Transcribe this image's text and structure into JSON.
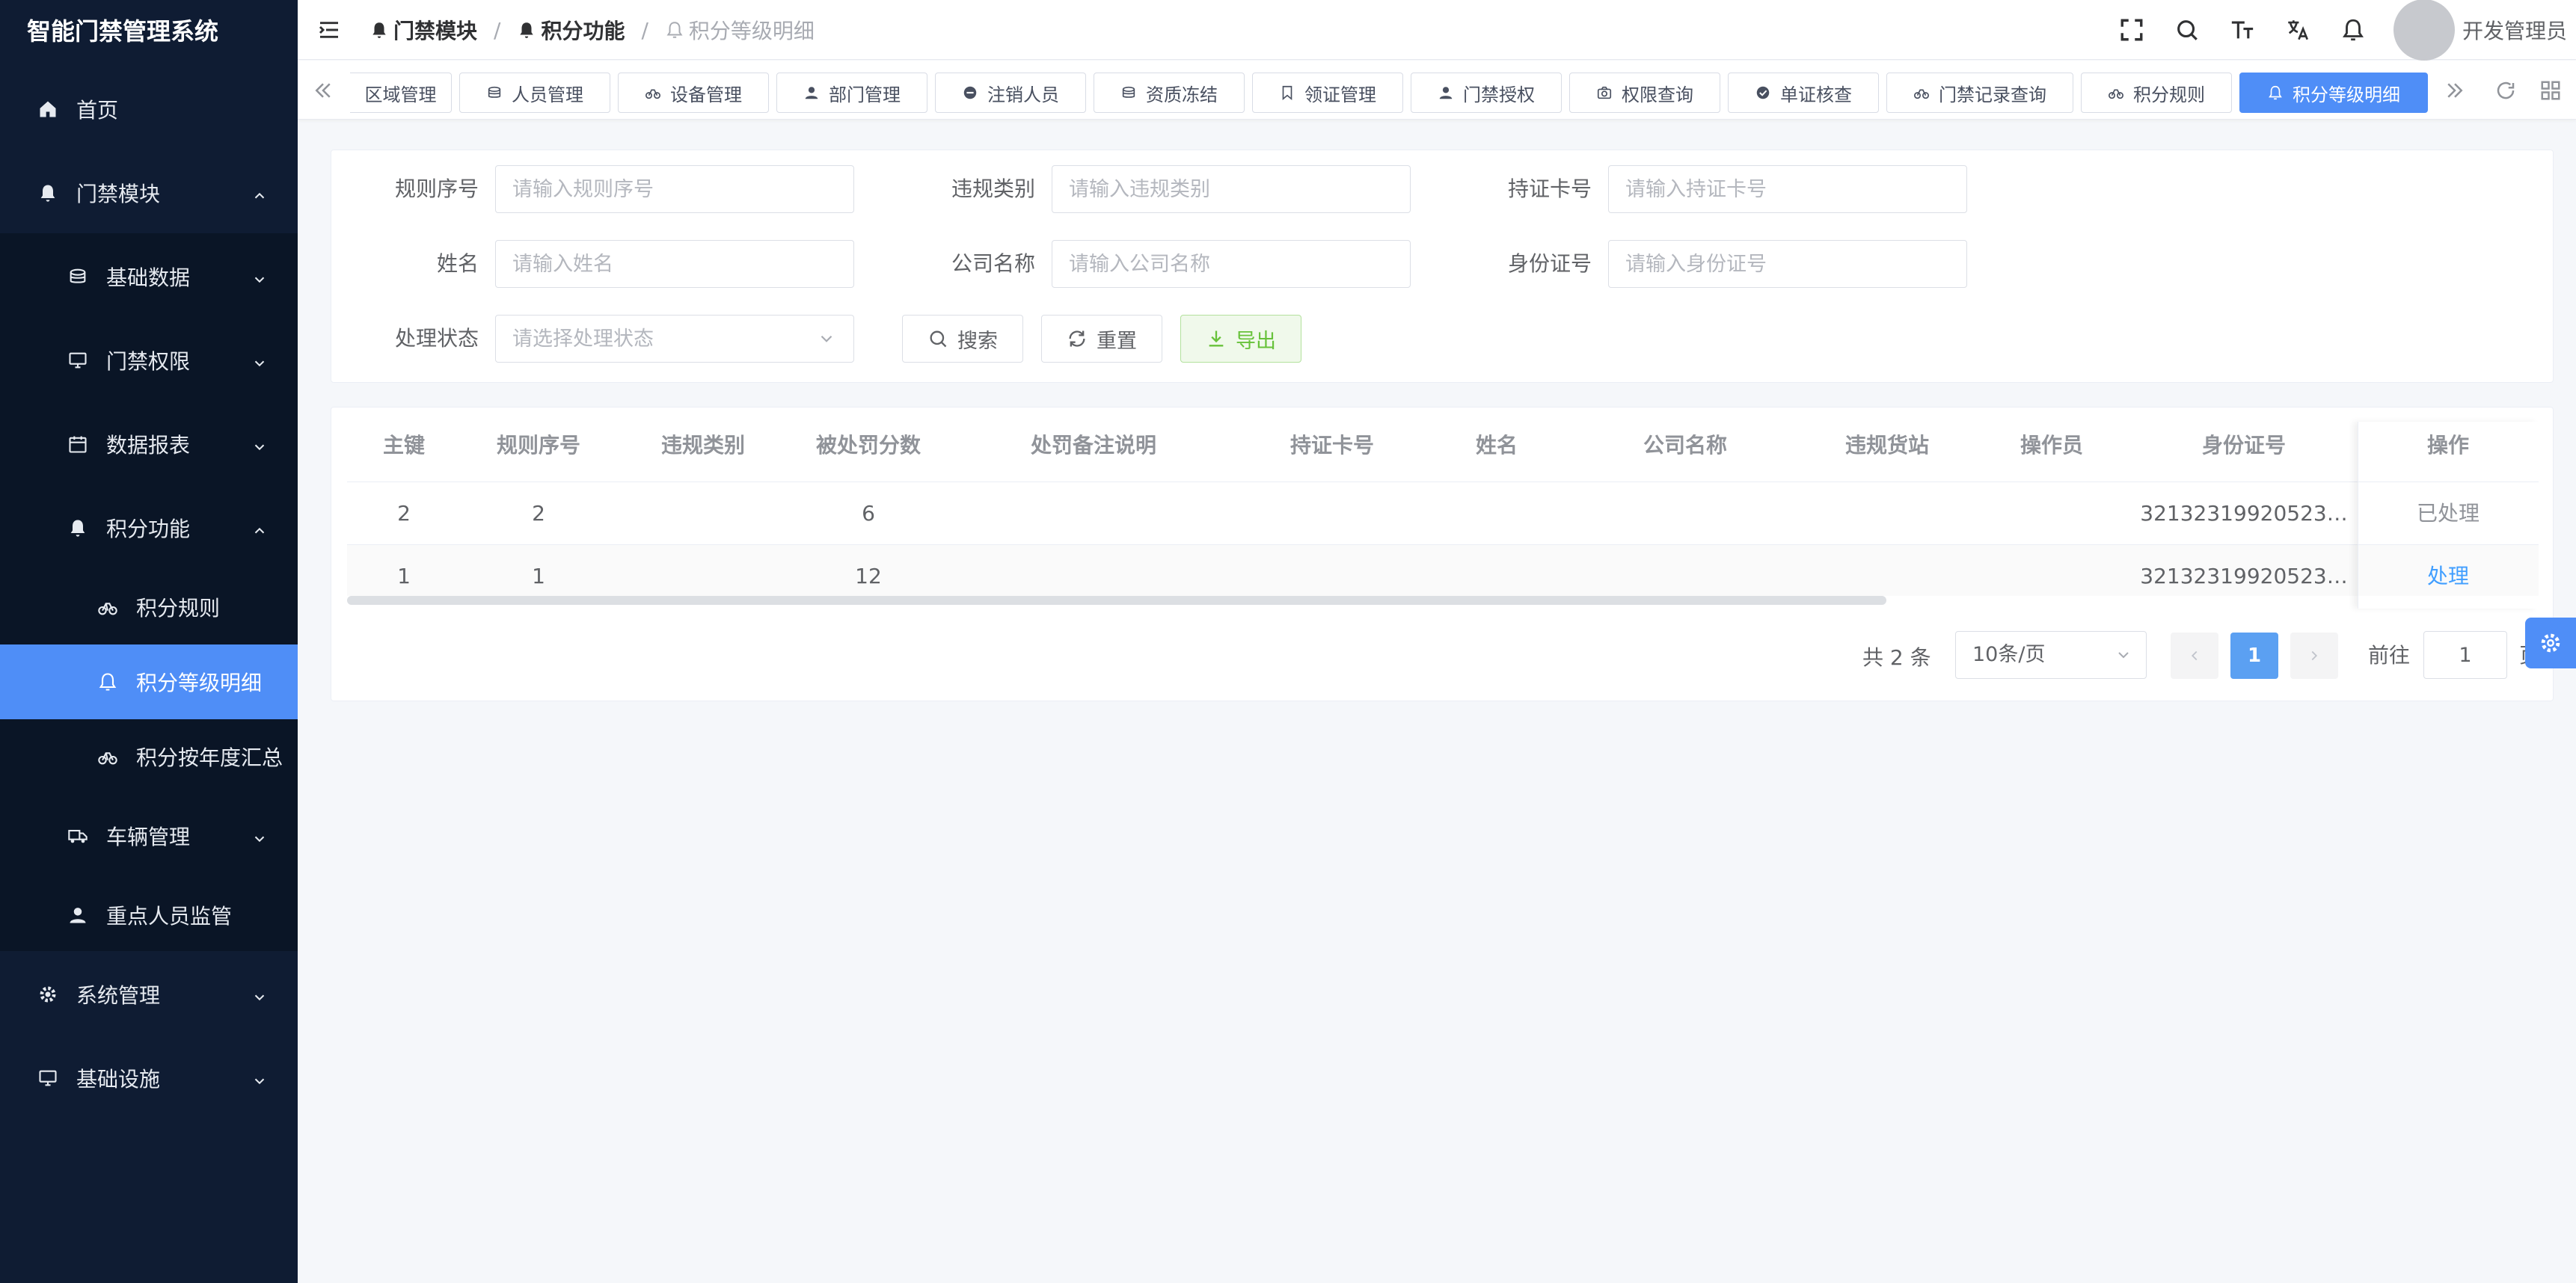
{
  "app": {
    "title": "智能门禁管理系统"
  },
  "sidebar": {
    "items": [
      {
        "label": "首页"
      },
      {
        "label": "门禁模块"
      },
      {
        "label": "基础数据"
      },
      {
        "label": "门禁权限"
      },
      {
        "label": "数据报表"
      },
      {
        "label": "积分功能"
      },
      {
        "label": "积分规则"
      },
      {
        "label": "积分等级明细"
      },
      {
        "label": "积分按年度汇总"
      },
      {
        "label": "车辆管理"
      },
      {
        "label": "重点人员监管"
      },
      {
        "label": "系统管理"
      },
      {
        "label": "基础设施"
      }
    ]
  },
  "breadcrumb": [
    "门禁模块",
    "积分功能",
    "积分等级明细"
  ],
  "header": {
    "user_name": "开发管理员"
  },
  "tags": [
    "区域管理",
    "人员管理",
    "设备管理",
    "部门管理",
    "注销人员",
    "资质冻结",
    "领证管理",
    "门禁授权",
    "权限查询",
    "单证核查",
    "门禁记录查询",
    "积分规则",
    "积分等级明细"
  ],
  "search": {
    "fields": [
      {
        "label": "规则序号",
        "placeholder": "请输入规则序号",
        "value": ""
      },
      {
        "label": "违规类别",
        "placeholder": "请输入违规类别",
        "value": ""
      },
      {
        "label": "持证卡号",
        "placeholder": "请输入持证卡号",
        "value": ""
      },
      {
        "label": "姓名",
        "placeholder": "请输入姓名",
        "value": ""
      },
      {
        "label": "公司名称",
        "placeholder": "请输入公司名称",
        "value": ""
      },
      {
        "label": "身份证号",
        "placeholder": "请输入身份证号",
        "value": ""
      },
      {
        "label": "处理状态",
        "placeholder": "请选择处理状态",
        "value": ""
      }
    ],
    "search_label": "搜索",
    "reset_label": "重置",
    "export_label": "导出"
  },
  "table": {
    "columns": [
      "主键",
      "规则序号",
      "违规类别",
      "被处罚分数",
      "处罚备注说明",
      "持证卡号",
      "姓名",
      "公司名称",
      "违规货站",
      "操作员",
      "身份证号",
      "操作"
    ],
    "rows": [
      {
        "id": "2",
        "rule_no": "2",
        "category": "",
        "points": "6",
        "remark": "",
        "card_no": "",
        "name": "",
        "company": "",
        "station": "",
        "operator": "",
        "id_card": "32132319920523…",
        "action": "已处理"
      },
      {
        "id": "1",
        "rule_no": "1",
        "category": "",
        "points": "12",
        "remark": "",
        "card_no": "",
        "name": "",
        "company": "",
        "station": "",
        "operator": "",
        "id_card": "32132319920523…",
        "action": "处理"
      }
    ]
  },
  "pagination": {
    "total_text": "共 2 条",
    "page_size": "10条/页",
    "current_page": "1",
    "goto_label": "前往",
    "goto_value": "1",
    "goto_suffix": "页"
  },
  "colors": {
    "sidebar_bg": "#0f1c33",
    "accent": "#4f8ef7",
    "export_green": "#67c23a",
    "link_blue": "#409eff"
  }
}
